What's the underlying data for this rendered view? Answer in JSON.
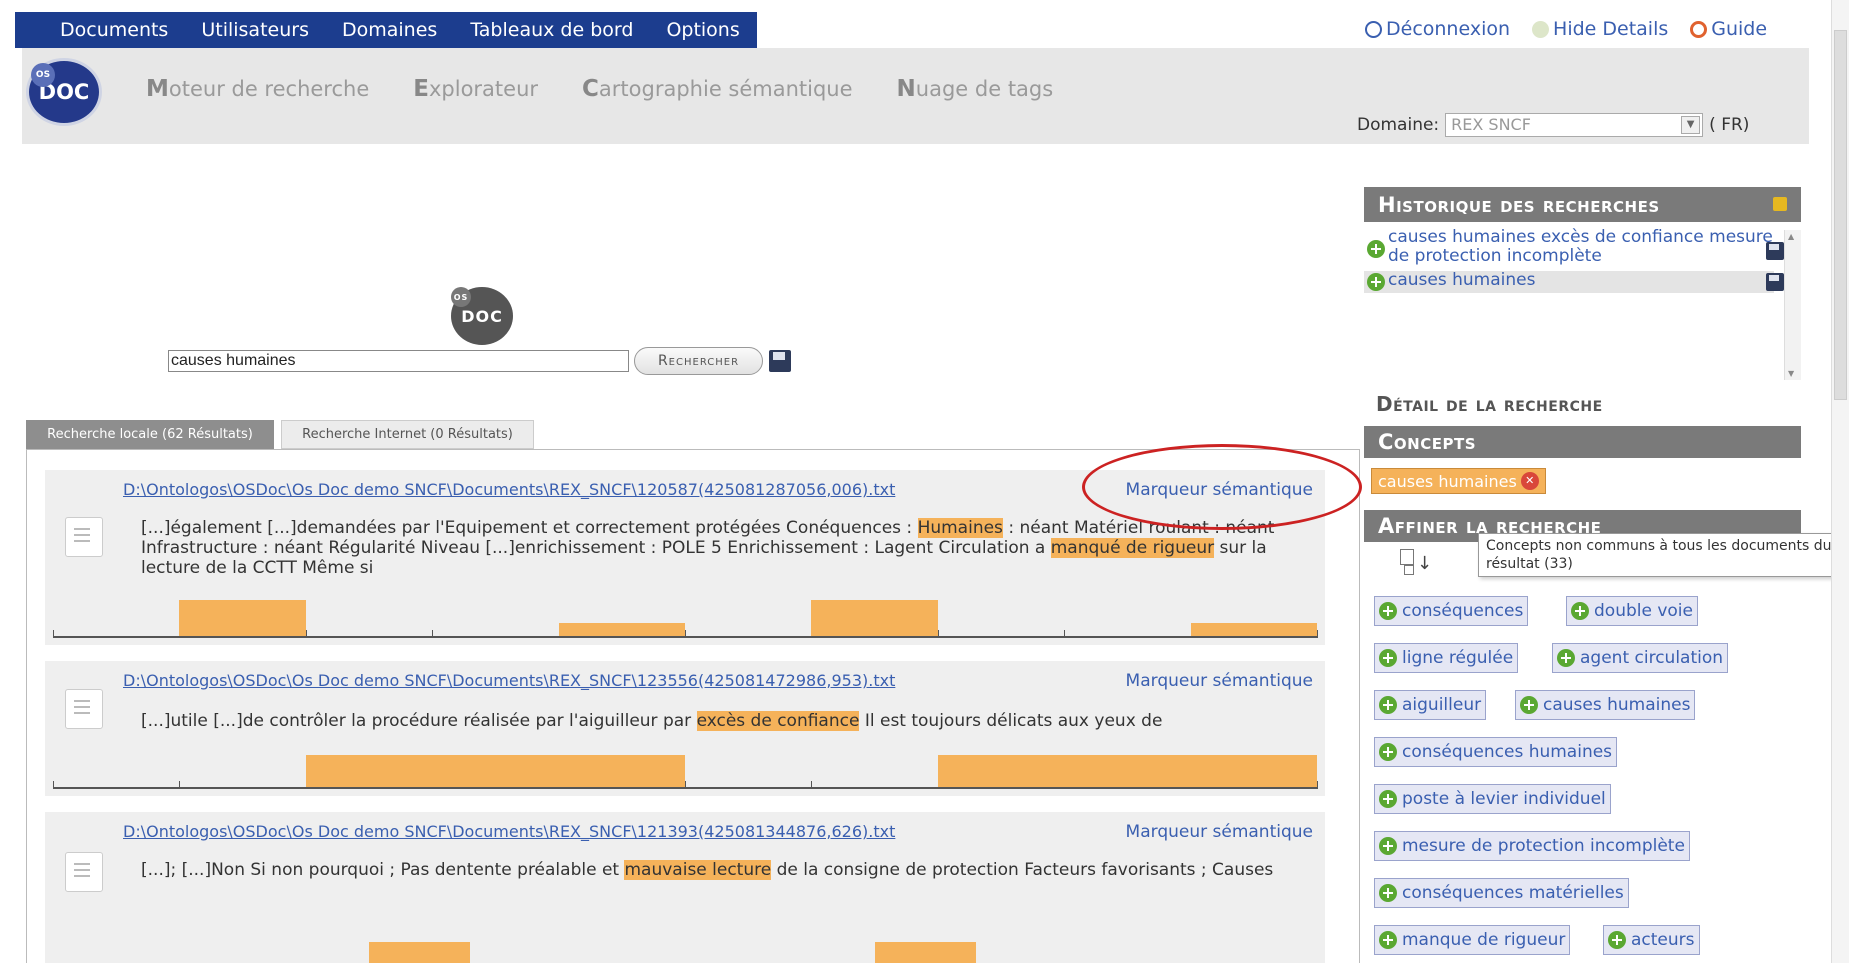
{
  "topnav": {
    "items": [
      "Documents",
      "Utilisateurs",
      "Domaines",
      "Tableaux de bord",
      "Options"
    ]
  },
  "toplinks": {
    "logout": "Déconnexion",
    "hide_details": "Hide Details",
    "guide": "Guide"
  },
  "logo": {
    "text": "DOC",
    "badge": "OS"
  },
  "subnav": {
    "items": [
      {
        "first": "M",
        "rest": "oteur de recherche"
      },
      {
        "first": "E",
        "rest": "xplorateur"
      },
      {
        "first": "C",
        "rest": "artographie sémantique"
      },
      {
        "first": "N",
        "rest": "uage de tags"
      }
    ]
  },
  "domaine": {
    "label": "Domaine:",
    "value": "REX SNCF",
    "lang": "( FR)"
  },
  "search": {
    "value": "causes humaines",
    "button": "Rechercher"
  },
  "tabs": {
    "local": "Recherche locale (62 Résultats)",
    "internet": "Recherche Internet (0 Résultats)"
  },
  "results": [
    {
      "path": "D:\\Ontologos\\OSDoc\\Os Doc demo SNCF\\Documents\\REX_SNCF\\120587(425081287056,006).txt",
      "marker": "Marqueur sémantique",
      "snippet_parts": [
        {
          "t": "[...]également [...]demandées par l'Equipement et correctement protégées Conéquences : ",
          "h": false
        },
        {
          "t": "Humaines",
          "h": true
        },
        {
          "t": " : néant Matériel roulant : néant Infrastructure : néant Régularité Niveau [...]enrichissement : POLE 5 Enrichissement : Lagent Circulation a ",
          "h": false
        },
        {
          "t": "manqué de rigueur",
          "h": true
        },
        {
          "t": " sur la lecture de la CCTT Même si",
          "h": false
        }
      ],
      "bars": [
        [
          0.1,
          0.2,
          1.0
        ],
        [
          0.4,
          0.5,
          0.35
        ],
        [
          0.6,
          0.7,
          1.0
        ],
        [
          0.9,
          1.0,
          0.35
        ]
      ]
    },
    {
      "path": "D:\\Ontologos\\OSDoc\\Os Doc demo SNCF\\Documents\\REX_SNCF\\123556(425081472986,953).txt",
      "marker": "Marqueur sémantique",
      "snippet_parts": [
        {
          "t": "[...]utile [...]de contrôler la procédure réalisée par l'aiguilleur par ",
          "h": false
        },
        {
          "t": "excès de confiance",
          "h": true
        },
        {
          "t": " Il est toujours délicats aux yeux de",
          "h": false
        }
      ],
      "bars": [
        [
          0.2,
          0.5,
          1.0
        ],
        [
          0.7,
          1.0,
          1.0
        ]
      ]
    },
    {
      "path": "D:\\Ontologos\\OSDoc\\Os Doc demo SNCF\\Documents\\REX_SNCF\\121393(425081344876,626).txt",
      "marker": "Marqueur sémantique",
      "snippet_parts": [
        {
          "t": "[...]; [...]Non Si non pourquoi ; Pas dentente préalable et ",
          "h": false
        },
        {
          "t": "mauvaise lecture",
          "h": true
        },
        {
          "t": " de la consigne de protection Facteurs favorisants ; Causes",
          "h": false
        }
      ],
      "bars": [
        [
          0.25,
          0.33,
          1.0
        ],
        [
          0.65,
          0.73,
          1.0
        ]
      ]
    }
  ],
  "history": {
    "title": "Historique des recherches",
    "items": [
      {
        "text": "causes humaines excès de confiance mesure de protection incomplète"
      },
      {
        "text": "causes humaines"
      }
    ]
  },
  "detail": {
    "title": "Détail de la recherche"
  },
  "concepts": {
    "title": "Concepts",
    "selected": "causes humaines"
  },
  "refine": {
    "title": "Affiner la recherche",
    "tooltip": "Concepts non communs à tous les documents du résultat (33)",
    "tags": [
      "conséquences",
      "double voie",
      "ligne régulée",
      "agent circulation",
      "aiguilleur",
      "causes humaines",
      "conséquences humaines",
      "poste à levier individuel",
      "mesure de protection incomplète",
      "conséquences matérielles",
      "manque de rigueur",
      "acteurs"
    ]
  },
  "colors": {
    "nav_bg": "#1c3d8e",
    "highlight": "#f5b25a",
    "link": "#3a5fb0",
    "panel_head": "#7a7a7a",
    "annotation_circle": "#cc2222"
  }
}
